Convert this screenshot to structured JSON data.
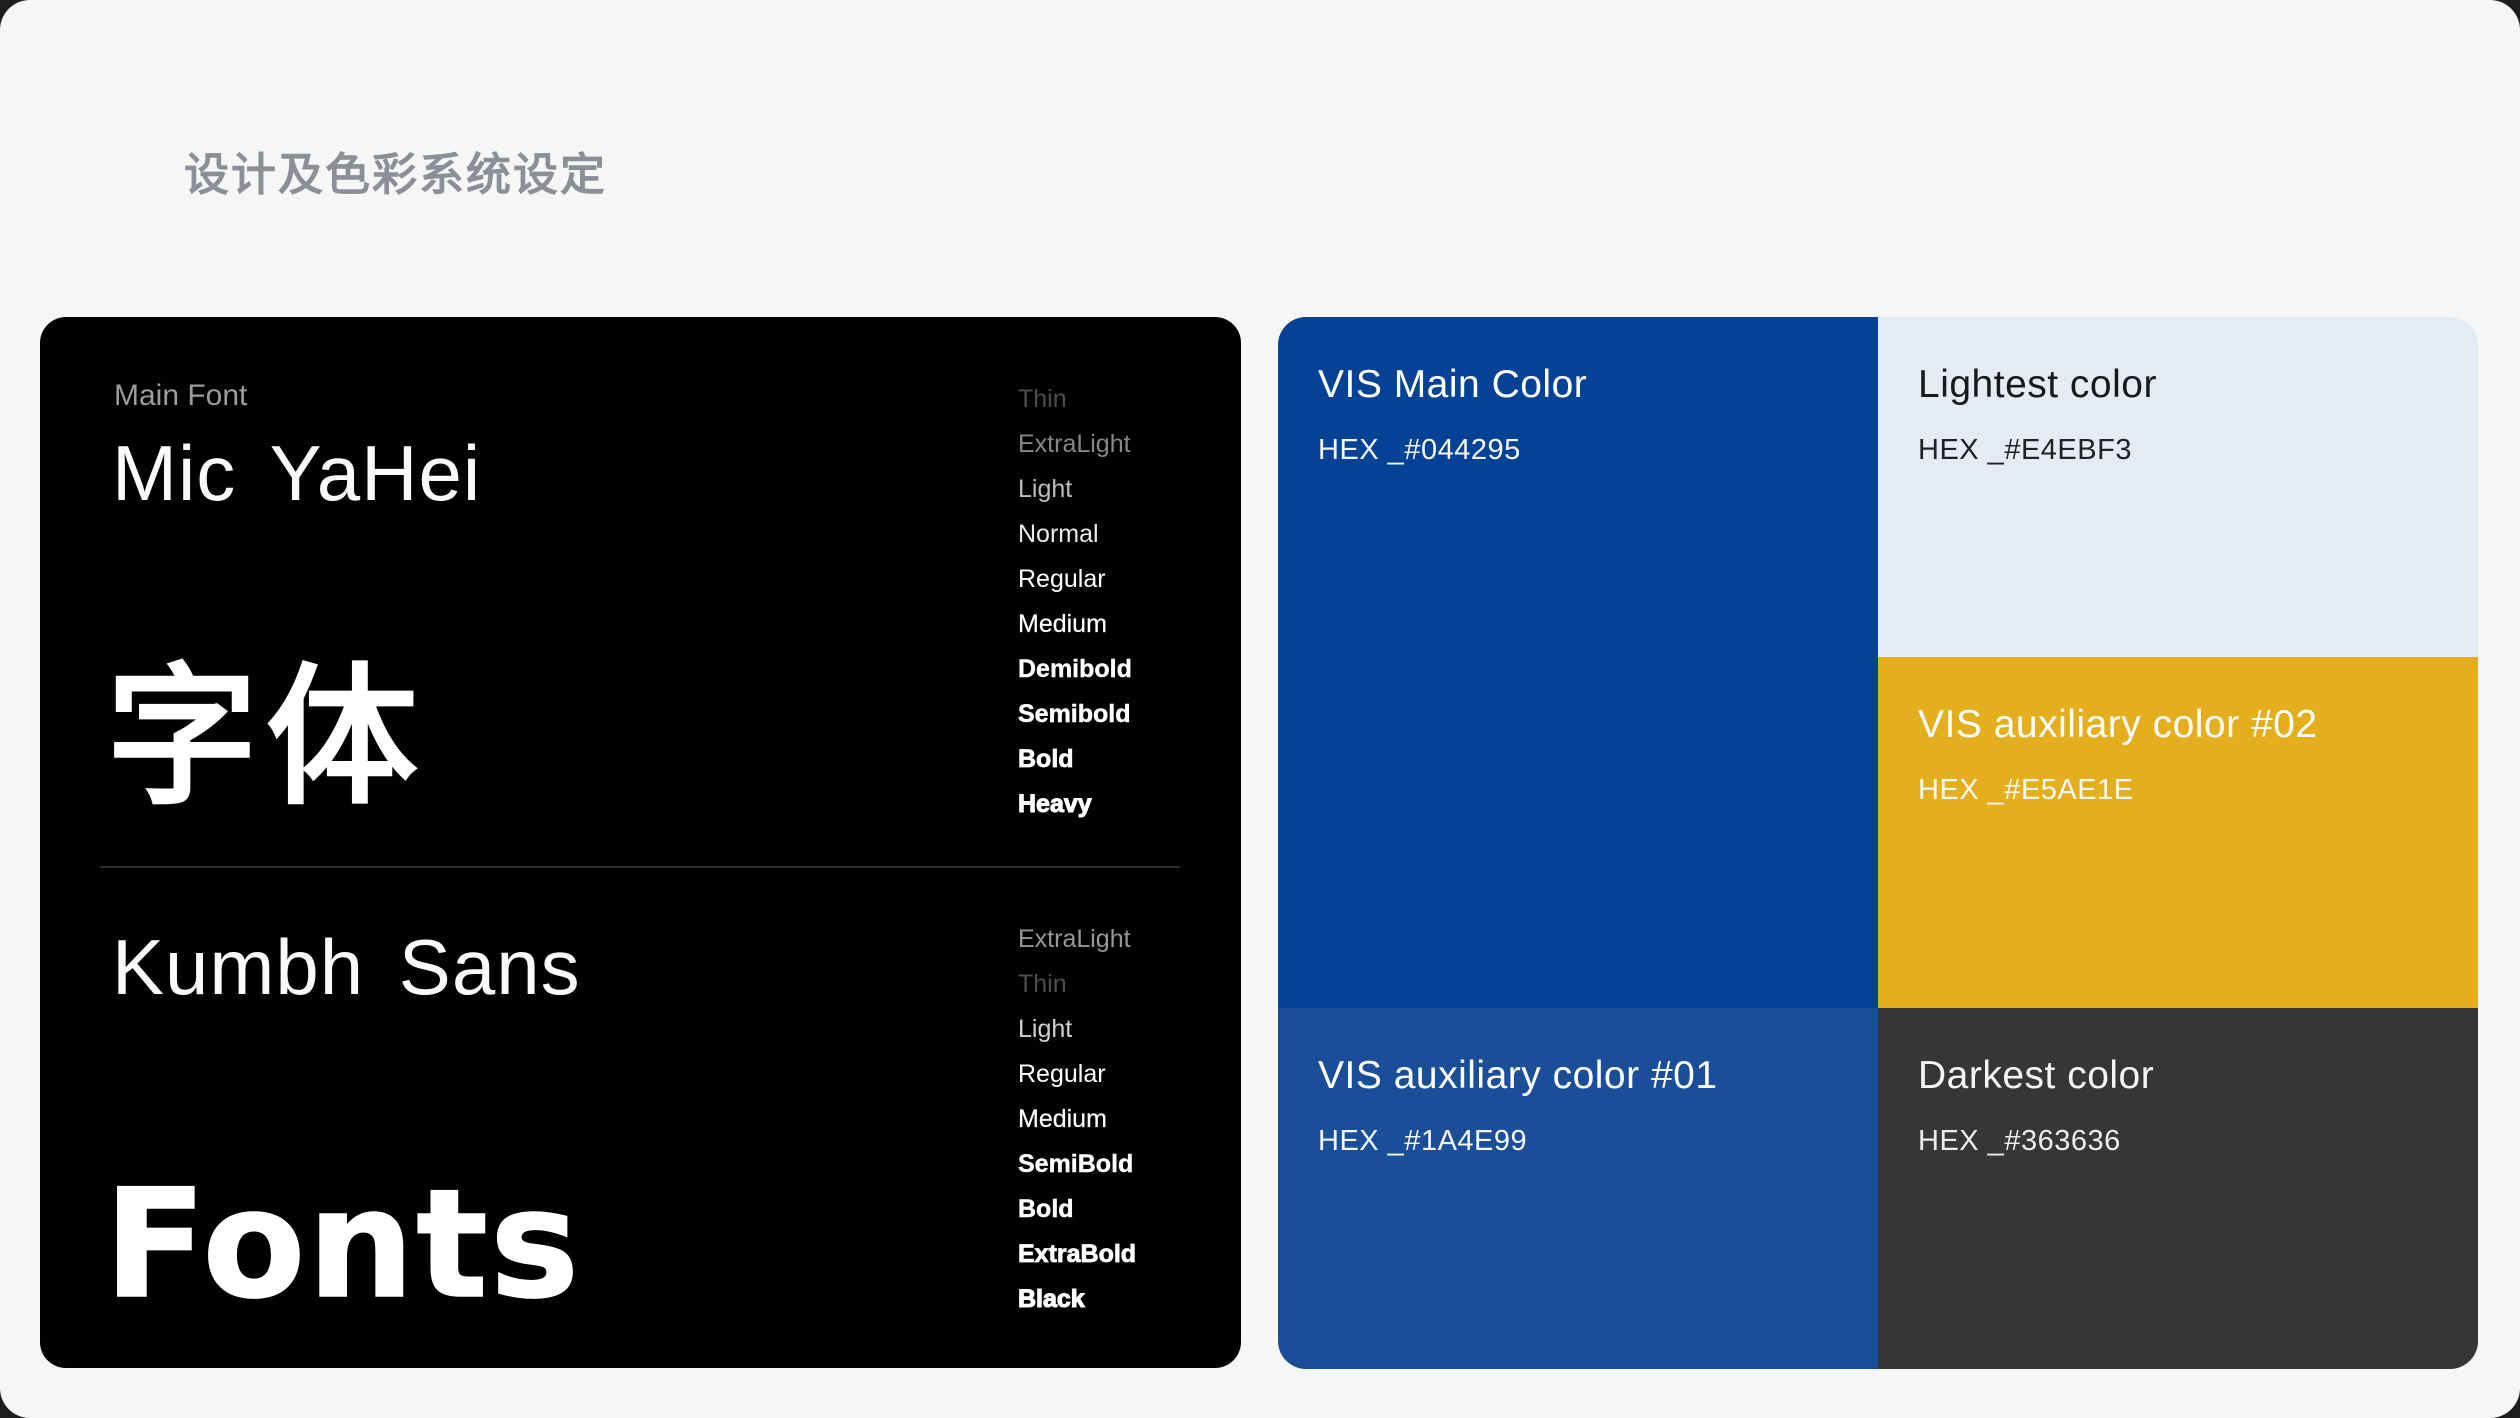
{
  "window": {
    "background": "#F6F6F7"
  },
  "header": {
    "title": "设计及色彩系统设定",
    "title_color": "#8B8F97"
  },
  "font_card": {
    "background": "#010101",
    "label": "Main Font",
    "specimens": [
      {
        "name": "Mic YaHei",
        "sample": "字体",
        "weights": [
          "Thin",
          "ExtraLight",
          "Light",
          "Normal",
          "Regular",
          "Medium",
          "Demibold",
          "Semibold",
          "Bold",
          "Heavy"
        ]
      },
      {
        "name": "Kumbh Sans",
        "sample": "Fonts",
        "weights": [
          "ExtraLight",
          "Thin",
          "Light",
          "Regular",
          "Medium",
          "SemiBold",
          "Bold",
          "ExtraBold",
          "Black"
        ]
      }
    ]
  },
  "palette": {
    "cards": [
      {
        "name": "VIS Main Color",
        "hex": "HEX _#044295",
        "color": "#044295",
        "text": "#FFFFFF"
      },
      {
        "name": "Lightest color",
        "hex": "HEX _#E4EBF3",
        "color": "#E4EBF3",
        "text": "#17191C"
      },
      {
        "name": "VIS auxiliary color #02",
        "hex": "HEX _#E5AE1E",
        "color": "#E5AE1E",
        "text": "#FFFFFF"
      },
      {
        "name": "VIS auxiliary color #01",
        "hex": "HEX _#1A4E99",
        "color": "#1A4E99",
        "text": "#FFFFFF"
      },
      {
        "name": "Darkest color",
        "hex": "HEX _#363636",
        "color": "#363636",
        "text": "#F5F5F5"
      }
    ]
  }
}
